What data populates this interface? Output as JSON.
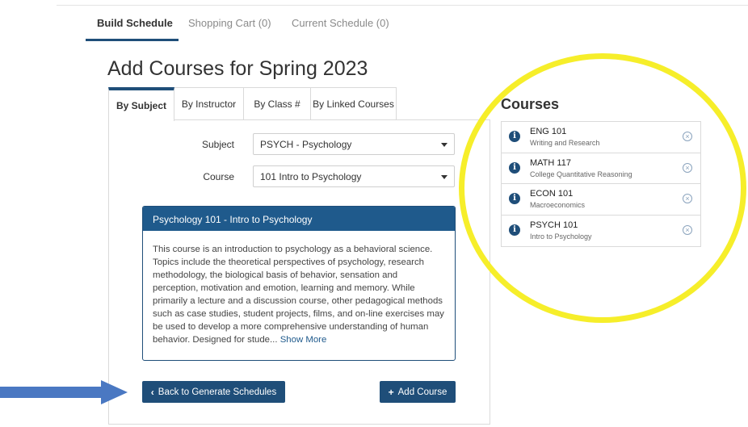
{
  "nav": {
    "tabs": [
      {
        "label": "Build Schedule",
        "active": true
      },
      {
        "label": "Shopping Cart (0)",
        "active": false
      },
      {
        "label": "Current Schedule (0)",
        "active": false
      }
    ]
  },
  "main": {
    "title": "Add Courses for Spring 2023",
    "search_tabs": [
      {
        "label": "By Subject",
        "active": true
      },
      {
        "label": "By Instructor",
        "active": false
      },
      {
        "label": "By Class #",
        "active": false
      },
      {
        "label": "By Linked Courses",
        "active": false
      }
    ],
    "subject": {
      "label": "Subject",
      "value": "PSYCH - Psychology"
    },
    "course": {
      "label": "Course",
      "value": "101 Intro to Psychology"
    },
    "description": {
      "heading": "Psychology 101 - Intro to Psychology",
      "text": "This course is an introduction to psychology as a behavioral science. Topics include the theoretical perspectives of psychology, research methodology, the biological basis of behavior, sensation and perception, motivation and emotion, learning and memory. While primarily a lecture and a discussion course, other pedagogical methods such as case studies, student projects, films, and on-line exercises may be used to develop a more comprehensive understanding of human behavior. Designed for stude...",
      "more_link": "Show More"
    },
    "back_button": "Back to Generate Schedules",
    "add_button": "Add Course"
  },
  "courses": {
    "title": "Courses",
    "items": [
      {
        "code": "ENG 101",
        "name": "Writing and Research"
      },
      {
        "code": "MATH 117",
        "name": "College Quantitative Reasoning"
      },
      {
        "code": "ECON 101",
        "name": "Macroeconomics"
      },
      {
        "code": "PSYCH 101",
        "name": "Intro to Psychology"
      }
    ]
  },
  "colors": {
    "primary": "#1f4e79",
    "highlight_ring": "#f6ee2a",
    "annotation_arrow": "#4a78c2"
  },
  "icons": {
    "back": "chevron-left-icon",
    "add": "plus-icon",
    "info": "info-icon",
    "remove": "remove-circle-icon"
  }
}
